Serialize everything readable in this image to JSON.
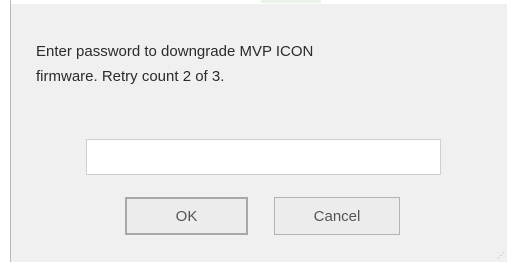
{
  "dialog": {
    "message": "Enter password to downgrade MVP ICON\nfirmware. Retry count 2 of 3.",
    "password": {
      "value": "",
      "placeholder": ""
    },
    "buttons": {
      "ok_label": "OK",
      "cancel_label": "Cancel"
    }
  },
  "icons": {
    "resize_grip": "resize-grip-icon"
  },
  "colors": {
    "dialog_background": "#f0f0f0",
    "text": "#2b2b2b",
    "button_background": "#ececec",
    "button_text": "#555555"
  }
}
